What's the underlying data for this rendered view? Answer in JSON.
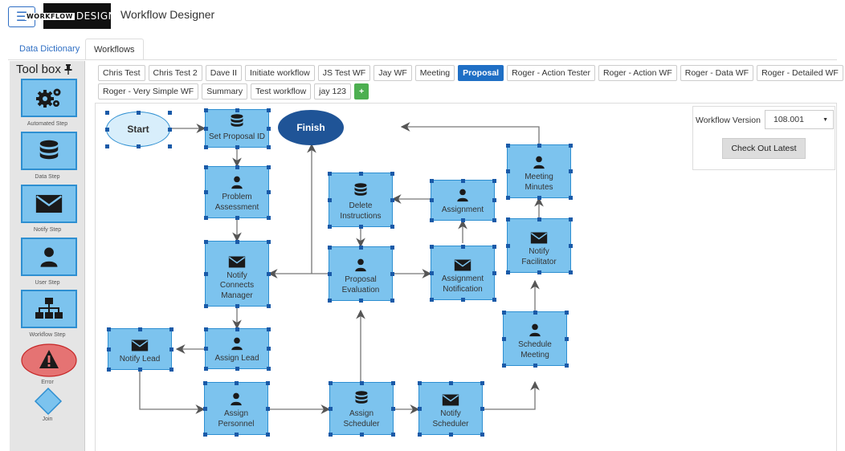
{
  "header": {
    "menu_icon": "hamburger-icon",
    "logo_text": "DESIGNER",
    "logo_prefix": "WORKFLOW",
    "title": "Workflow Designer"
  },
  "top_tabs": [
    {
      "label": "Data Dictionary",
      "active": false
    },
    {
      "label": "Workflows",
      "active": true
    }
  ],
  "toolbox": {
    "title": "Tool box",
    "pin_icon": "pin-icon",
    "tools": [
      {
        "label": "Automated Step",
        "icon": "gears-icon"
      },
      {
        "label": "Data Step",
        "icon": "database-icon"
      },
      {
        "label": "Notify Step",
        "icon": "envelope-icon"
      },
      {
        "label": "User Step",
        "icon": "user-icon"
      },
      {
        "label": "Workflow Step",
        "icon": "sitemap-icon"
      },
      {
        "label": "Error",
        "icon": "warning-icon"
      },
      {
        "label": "Join",
        "icon": "diamond-icon"
      }
    ]
  },
  "workflow_tabs": [
    "Chris Test",
    "Chris Test 2",
    "Dave II",
    "Initiate workflow",
    "JS Test WF",
    "Jay WF",
    "Meeting",
    "Proposal",
    "Roger - Action Tester",
    "Roger - Action WF",
    "Roger - Data WF",
    "Roger - Detailed WF",
    "Roger - Very Simple WF",
    "Summary",
    "Test workflow",
    "jay 123"
  ],
  "active_workflow": "Proposal",
  "add_workflow_icon": "plus-icon",
  "version_panel": {
    "label": "Workflow Version",
    "value": "108.001",
    "button": "Check Out Latest"
  },
  "diagram": {
    "start": "Start",
    "finish": "Finish",
    "nodes": {
      "set_proposal_id": {
        "label": "Set Proposal ID",
        "icon": "database-icon"
      },
      "problem_assessment": {
        "label1": "Problem",
        "label2": "Assessment",
        "icon": "user-icon"
      },
      "notify_connects_manager": {
        "label1": "Notify",
        "label2": "Connects",
        "label3": "Manager",
        "icon": "envelope-icon"
      },
      "assign_lead": {
        "label": "Assign Lead",
        "icon": "user-icon"
      },
      "notify_lead": {
        "label": "Notify Lead",
        "icon": "envelope-icon"
      },
      "assign_personnel": {
        "label1": "Assign",
        "label2": "Personnel",
        "icon": "user-icon"
      },
      "delete_instructions": {
        "label1": "Delete",
        "label2": "Instructions",
        "icon": "database-icon"
      },
      "proposal_evaluation": {
        "label1": "Proposal",
        "label2": "Evaluation",
        "icon": "user-icon"
      },
      "assign_scheduler": {
        "label1": "Assign",
        "label2": "Scheduler",
        "icon": "database-icon"
      },
      "assignment": {
        "label": "Assignment",
        "icon": "user-icon"
      },
      "assignment_notification": {
        "label1": "Assignment",
        "label2": "Notification",
        "icon": "envelope-icon"
      },
      "notify_scheduler": {
        "label1": "Notify",
        "label2": "Scheduler",
        "icon": "envelope-icon"
      },
      "meeting_minutes": {
        "label1": "Meeting",
        "label2": "Minutes",
        "icon": "user-icon"
      },
      "notify_facilitator": {
        "label1": "Notify",
        "label2": "Facilitator",
        "icon": "envelope-icon"
      },
      "schedule_meeting": {
        "label1": "Schedule",
        "label2": "Meeting",
        "icon": "user-icon"
      }
    }
  }
}
